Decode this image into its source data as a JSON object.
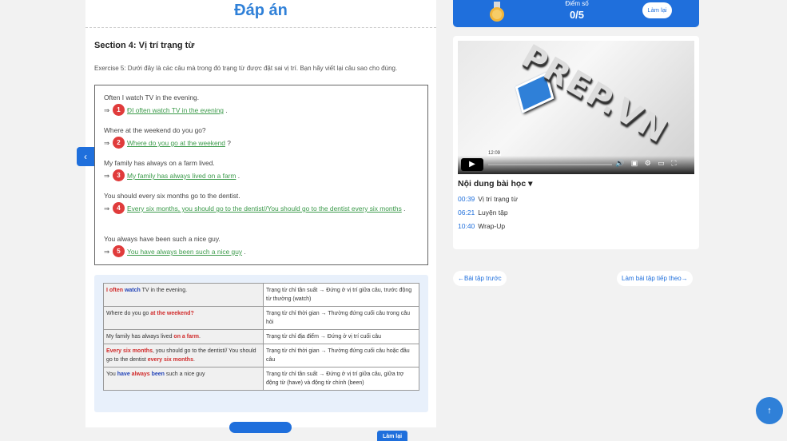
{
  "header": {
    "title": "Đáp án"
  },
  "section": {
    "title": "Section 4: Vị trí trạng từ",
    "exercise": "Exercise 5: Dưới đây là các câu mà trong đó trạng từ được đặt sai vị trí. Bạn hãy viết lại câu sao cho đúng."
  },
  "answers": [
    {
      "question": "Often I watch TV in the evening.",
      "arrow": "⇒",
      "num": "1",
      "answer": "ĐI often watch TV in the evening",
      "tail": " ."
    },
    {
      "question": "Where at the weekend do you go?",
      "arrow": "⇒",
      "num": "2",
      "answer": "Where do you go at the weekend",
      "tail": " ?"
    },
    {
      "question": "My family has always on a farm lived.",
      "arrow": "⇒",
      "num": "3",
      "answer": "My family has always lived on a farm",
      "tail": " ."
    },
    {
      "question": "You should every six months go to the dentist.",
      "arrow": "⇒",
      "num": "4",
      "answer": "Every six months, you should go to the dentist//You should go to the dentist every six months",
      "tail": " ."
    },
    {
      "question": "You always have been such a nice guy.",
      "arrow": "⇒",
      "num": "5",
      "answer": "You have always been such a nice guy",
      "tail": " ."
    }
  ],
  "explanation_table": [
    {
      "left": [
        {
          "t": "I ",
          "c": "red"
        },
        {
          "t": "often ",
          "c": "red"
        },
        {
          "t": "watch",
          "c": "blue"
        },
        {
          "t": " TV in the evening.",
          "c": ""
        }
      ],
      "right": "Trạng từ chỉ tần suất → Đứng ở vị trí giữa câu, trước động từ thường (watch)"
    },
    {
      "left": [
        {
          "t": "Where do you go ",
          "c": ""
        },
        {
          "t": "at the weekend?",
          "c": "red"
        }
      ],
      "right": "Trạng từ chỉ thời gian → Thường đứng cuối câu trong câu hỏi"
    },
    {
      "left": [
        {
          "t": "My family has always lived ",
          "c": ""
        },
        {
          "t": "on a farm",
          "c": "red"
        },
        {
          "t": ".",
          "c": ""
        }
      ],
      "right": "Trạng từ chỉ địa điểm → Đứng ở vị trí cuối câu"
    },
    {
      "left": [
        {
          "t": "Every six months",
          "c": "red"
        },
        {
          "t": ", you should go to the dentist// You should go to the dentist ",
          "c": ""
        },
        {
          "t": "every six months",
          "c": "red"
        },
        {
          "t": ".",
          "c": ""
        }
      ],
      "right": "Trạng từ chỉ thời gian → Thường đứng cuối câu hoặc đầu câu"
    },
    {
      "left": [
        {
          "t": "You ",
          "c": ""
        },
        {
          "t": "have ",
          "c": "blue"
        },
        {
          "t": "always ",
          "c": "red"
        },
        {
          "t": "been",
          "c": "blue"
        },
        {
          "t": " such a nice guy",
          "c": ""
        }
      ],
      "right": "Trạng từ chỉ tần suất → Đứng ở vị trí giữa câu, giữa trợ động từ (have) và động từ chính (been)"
    }
  ],
  "bottom": {
    "redo_label": "Làm lại"
  },
  "side_tab": {
    "icon": "‹"
  },
  "score": {
    "label": "Điểm số",
    "value": "0/5",
    "redo_label": "Làm lại"
  },
  "video": {
    "brand": "PREP.VN",
    "time_tip": "12:09",
    "play_icon": "▶",
    "control_icons": "🔊 ▣ ⚙ ▭ ⛶"
  },
  "lessons": {
    "title": "Nội dung bài học",
    "caret": "▾",
    "items": [
      {
        "time": "00:39",
        "label": "Vị trí trạng từ"
      },
      {
        "time": "06:21",
        "label": "Luyện tập"
      },
      {
        "time": "10:40",
        "label": "Wrap-Up"
      }
    ]
  },
  "nav": {
    "prev": "←Bài tập trước",
    "next": "Làm bài tập tiếp theo→"
  },
  "fab": {
    "icon": "↑"
  },
  "colors": {
    "primary": "#1f6fdc",
    "answer_green": "#3b9a4a",
    "badge_red": "#e03b3b"
  }
}
